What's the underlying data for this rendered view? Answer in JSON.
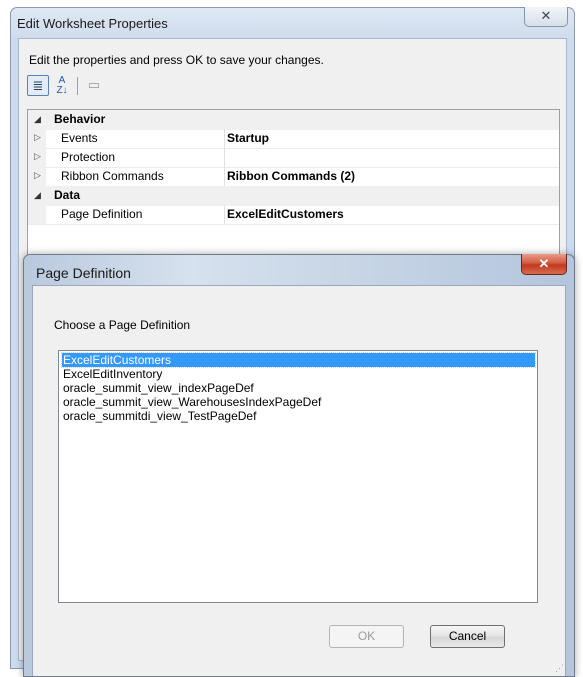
{
  "outer_dialog": {
    "title": "Edit Worksheet Properties",
    "close_label": "✕",
    "instructions": "Edit the properties and press OK to save your changes.",
    "toolbar": {
      "categorized_icon": "≣",
      "alphabetical_top": "A",
      "alphabetical_bottom": "Z↓",
      "property_pages_icon": "▭"
    },
    "grid": {
      "rows": [
        {
          "type": "category",
          "expander": "◢",
          "name": "Behavior",
          "value": ""
        },
        {
          "type": "property",
          "expander": "▷",
          "name": "Events",
          "value": "Startup"
        },
        {
          "type": "property",
          "expander": "▷",
          "name": "Protection",
          "value": ""
        },
        {
          "type": "property",
          "expander": "▷",
          "name": "Ribbon Commands",
          "value": "Ribbon Commands (2)"
        },
        {
          "type": "category",
          "expander": "◢",
          "name": "Data",
          "value": ""
        },
        {
          "type": "property",
          "expander": "",
          "name": "Page Definition",
          "value": "ExcelEditCustomers"
        }
      ]
    }
  },
  "page_definition_dialog": {
    "title": "Page Definition",
    "close_label": "✕",
    "prompt": "Choose a Page Definition",
    "items": [
      "ExcelEditCustomers",
      "ExcelEditInventory",
      "oracle_summit_view_indexPageDef",
      "oracle_summit_view_WarehousesIndexPageDef",
      "oracle_summitdi_view_TestPageDef"
    ],
    "selected_index": 0,
    "ok_label": "OK",
    "cancel_label": "Cancel",
    "resize_grip_icon": "⋰"
  }
}
